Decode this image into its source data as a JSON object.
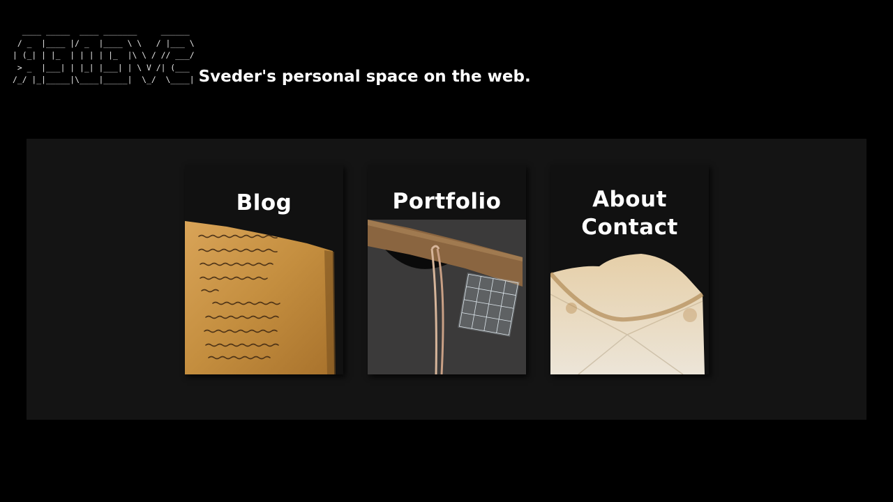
{
  "header": {
    "ascii_logo": "  ____ _____  ____ _______     ______\n / _  |____ |/ _  |____ \\ \\   / |___ \\\n| (_| | |_  | | | | |_  |\\ \\ / // ___/\n > _  |___| | |_| |___| | \\ V /| (___\n/_/ |_|_____|\\____|_____|  \\_/  \\____|",
    "tagline": "Sveder's personal space on the web."
  },
  "nav": {
    "cards": [
      {
        "title": "Blog",
        "image_icon": "scroll-manuscript-icon"
      },
      {
        "title": "Portfolio",
        "image_icon": "folder-document-icon"
      },
      {
        "title_line1": "About",
        "title_line2": "Contact",
        "image_icon": "envelope-icon"
      }
    ]
  },
  "colors": {
    "page_background": "#000000",
    "panel_background": "#141414",
    "card_background": "#111111",
    "text": "#ffffff"
  }
}
